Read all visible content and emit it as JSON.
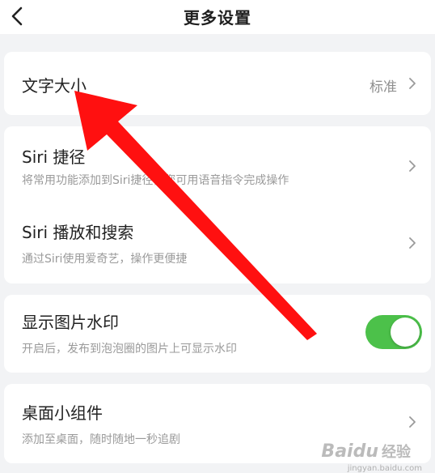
{
  "header": {
    "title": "更多设置",
    "back_icon": "chevron-left-icon"
  },
  "settings": {
    "font_size": {
      "title": "文字大小",
      "value": "标准"
    },
    "siri_shortcut": {
      "title": "Siri 捷径",
      "desc": "将常用功能添加到Siri捷径，您可用语音指令完成操作"
    },
    "siri_play": {
      "title": "Siri 播放和搜索",
      "desc": "通过Siri使用爱奇艺，操作更便捷"
    },
    "watermark": {
      "title": "显示图片水印",
      "desc": "开启后，发布到泡泡圈的图片上可显示水印",
      "enabled": true
    },
    "widget": {
      "title": "桌面小组件",
      "desc": "添加至桌面，随时随地一秒追剧"
    }
  },
  "overlay": {
    "arrow_color": "#ff1010",
    "watermark_brand": "Baidu",
    "watermark_sub": "经验",
    "watermark_url": "jingyan.baidu.com"
  },
  "colors": {
    "toggle_on": "#4cc14a",
    "background": "#f2f3f5"
  }
}
